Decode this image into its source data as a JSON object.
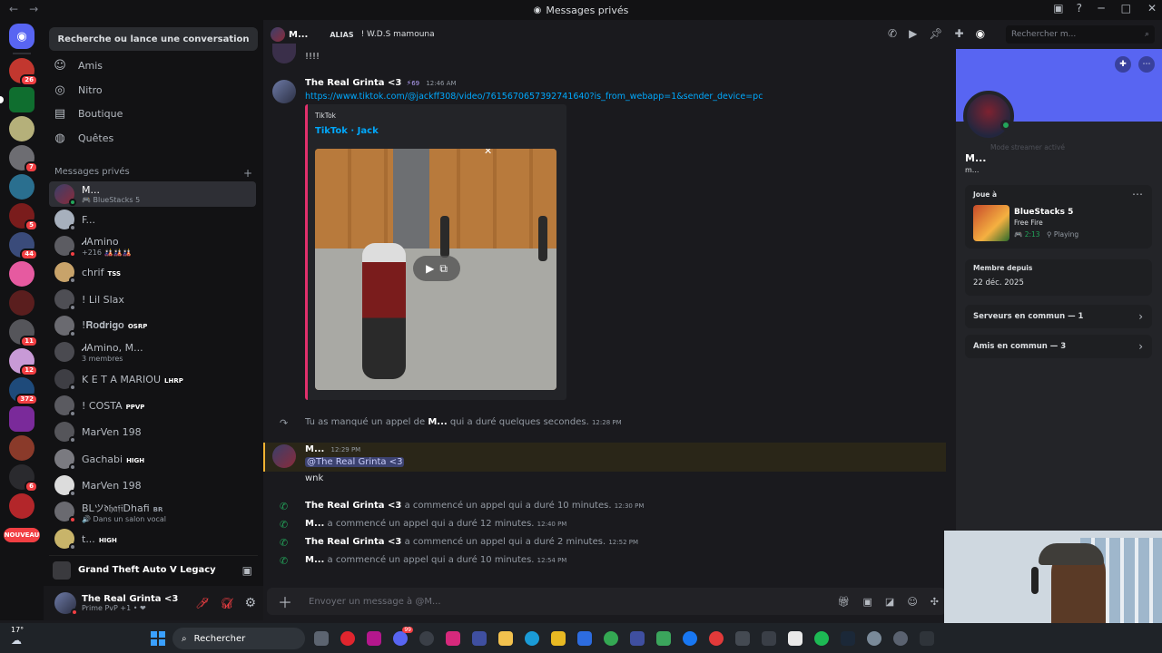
{
  "window": {
    "title": "Messages privés",
    "back": "←",
    "forward": "→"
  },
  "guild_badges": [
    "26",
    "",
    "",
    "7",
    "",
    "5",
    "44",
    "",
    "",
    "11",
    "12",
    "372",
    "",
    "",
    "6",
    "",
    "NOUVEAU"
  ],
  "sidebar": {
    "search_label": "Recherche ou lance une conversation",
    "nav": [
      {
        "label": "Amis",
        "icon": "friends-icon"
      },
      {
        "label": "Nitro",
        "icon": "nitro-icon"
      },
      {
        "label": "Boutique",
        "icon": "shop-icon"
      },
      {
        "label": "Quêtes",
        "icon": "quests-icon"
      }
    ],
    "dm_header": "Messages privés",
    "dm_add": "+",
    "dms": [
      {
        "name": "M...",
        "sub": "BlueStacks 5",
        "tag": ""
      },
      {
        "name": "F...",
        "sub": "",
        "tag": ""
      },
      {
        "name": "ᏗᎪmino",
        "sub": "+216 🎎🎎🎎",
        "tag": ""
      },
      {
        "name": "chrif",
        "sub": "",
        "tag": "TSS"
      },
      {
        "name": "! Lil Slax",
        "sub": "",
        "tag": ""
      },
      {
        "name": "!𝐑𝐨𝐝𝐫𝐢𝐠𝐨",
        "sub": "",
        "tag": "OSRP"
      },
      {
        "name": "ᏗᎪmino, M...",
        "sub": "3 membres",
        "tag": ""
      },
      {
        "name": "K E T A MARIOU",
        "sub": "",
        "tag": "LHRP"
      },
      {
        "name": "! COSTA",
        "sub": "",
        "tag": "PPVP"
      },
      {
        "name": "MarVen 198",
        "sub": "",
        "tag": ""
      },
      {
        "name": "Gachabi",
        "sub": "",
        "tag": "HIGH"
      },
      {
        "name": "MarVen 198",
        "sub": "",
        "tag": ""
      },
      {
        "name": "BLツ𝔡𝔥𝔞𝔣𝔦Dhafi",
        "sub": "Dans un salon vocal",
        "tag": "BR"
      },
      {
        "name": "t...",
        "sub": "",
        "tag": "HIGH"
      }
    ],
    "game_activity": "Grand Theft Auto V Legacy",
    "user": {
      "name": "The Real Grinta <3",
      "status": "Prime PvP +1 • ❤"
    }
  },
  "chat": {
    "header": {
      "name": "M...",
      "alias_label": "ALIAS",
      "alias_value": "! W.D.S mamouna",
      "search_placeholder": "Rechercher m..."
    },
    "top_text": "!!!!",
    "msg1": {
      "author": "The Real Grinta <3",
      "badge": "69",
      "time": "12:46 AM",
      "link": "https://www.tiktok.com/@jackff308/video/7615670657392741640?is_from_webapp=1&sender_device=pc"
    },
    "embed": {
      "provider": "TikTok",
      "title": "TikTok · Jack"
    },
    "missed": {
      "prefix": "Tu as manqué un appel de",
      "who": "M...",
      "suffix": "qui a duré quelques secondes.",
      "time": "12:28 PM"
    },
    "msg2": {
      "author": "M...",
      "time": "12:29 PM",
      "mention": "@The Real Grinta <3",
      "text": "wnk"
    },
    "calls": [
      {
        "who": "The Real Grinta <3",
        "text": "a commencé un appel qui a duré 10 minutes.",
        "time": "12:30 PM"
      },
      {
        "who": "M...",
        "text": "a commencé un appel qui a duré 12 minutes.",
        "time": "12:40 PM"
      },
      {
        "who": "The Real Grinta <3",
        "text": "a commencé un appel qui a duré 2 minutes.",
        "time": "12:52 PM"
      },
      {
        "who": "M...",
        "text": "a commencé un appel qui a duré 10 minutes.",
        "time": "12:54 PM"
      }
    ],
    "composer_placeholder": "Envoyer un message à @M..."
  },
  "profile": {
    "streamer_mode": "Mode streamer activé",
    "name": "M...",
    "username": "m...",
    "playing_label": "Joue à",
    "game_name": "BlueStacks 5",
    "game_sub": "Free Fire",
    "game_time": "2:13",
    "game_state": "Playing",
    "member_since_label": "Membre depuis",
    "member_since": "22 déc. 2025",
    "servers_common": "Serveurs en commun — 1",
    "friends_common": "Amis en commun — 3"
  },
  "taskbar": {
    "temp": "17°",
    "search": "Rechercher",
    "notif": "99"
  },
  "colors": {
    "accent": "#5865f2",
    "link": "#00a8fc",
    "online": "#23a55a",
    "danger": "#f23f43",
    "mention_bar": "#f0b232",
    "tiktok": "#e1306c"
  }
}
